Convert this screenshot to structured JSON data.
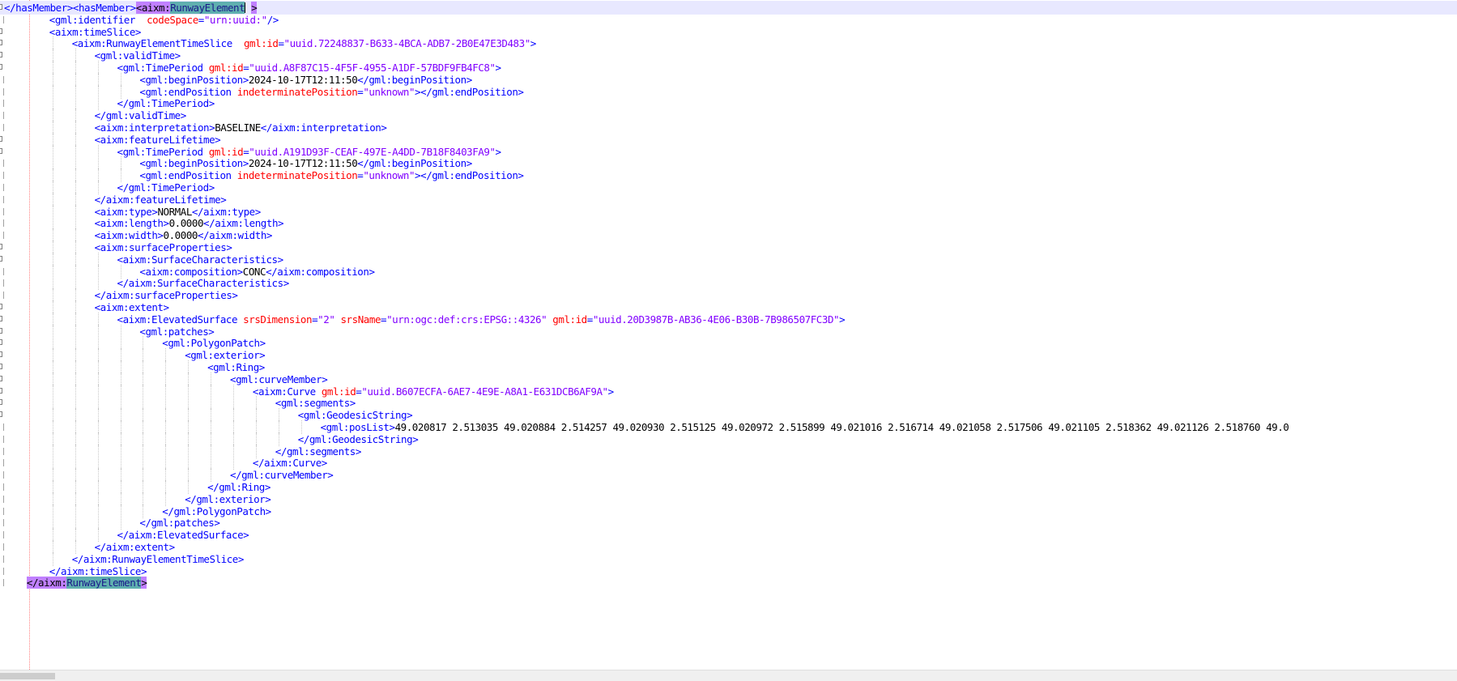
{
  "editor": {
    "lines": [
      {
        "indent": 0,
        "current": true,
        "fold": "box",
        "parts": [
          [
            "t",
            "</hasMember><hasMember>"
          ],
          [
            "hl",
            "<aixm:"
          ],
          [
            "hlsel",
            "RunwayElement"
          ],
          [
            "x",
            " "
          ],
          [
            "hl",
            ">"
          ]
        ]
      },
      {
        "indent": 2,
        "fold": "line",
        "parts": [
          [
            "t",
            "<gml:identifier  "
          ],
          [
            "a",
            "codeSpace"
          ],
          [
            "t",
            "="
          ],
          [
            "v",
            "\"urn:uuid:\""
          ],
          [
            "t",
            "/>"
          ]
        ]
      },
      {
        "indent": 2,
        "fold": "box",
        "parts": [
          [
            "t",
            "<aixm:timeSlice>"
          ]
        ]
      },
      {
        "indent": 3,
        "fold": "box",
        "parts": [
          [
            "t",
            "<aixm:RunwayElementTimeSlice  "
          ],
          [
            "a",
            "gml:id"
          ],
          [
            "t",
            "="
          ],
          [
            "v",
            "\"uuid.72248837-B633-4BCA-ADB7-2B0E47E3D483\""
          ],
          [
            "t",
            ">"
          ]
        ]
      },
      {
        "indent": 4,
        "fold": "box",
        "parts": [
          [
            "t",
            "<gml:validTime>"
          ]
        ]
      },
      {
        "indent": 5,
        "fold": "box",
        "parts": [
          [
            "t",
            "<gml:TimePeriod "
          ],
          [
            "a",
            "gml:id"
          ],
          [
            "t",
            "="
          ],
          [
            "v",
            "\"uuid.A8F87C15-4F5F-4955-A1DF-57BDF9FB4FC8\""
          ],
          [
            "t",
            ">"
          ]
        ]
      },
      {
        "indent": 6,
        "fold": "line",
        "parts": [
          [
            "t",
            "<gml:beginPosition>"
          ],
          [
            "x",
            "2024-10-17T12:11:50"
          ],
          [
            "t",
            "</gml:beginPosition>"
          ]
        ]
      },
      {
        "indent": 6,
        "fold": "line",
        "parts": [
          [
            "t",
            "<gml:endPosition "
          ],
          [
            "a",
            "indeterminatePosition"
          ],
          [
            "t",
            "="
          ],
          [
            "v",
            "\"unknown\""
          ],
          [
            "t",
            "></gml:endPosition>"
          ]
        ]
      },
      {
        "indent": 5,
        "fold": "line",
        "parts": [
          [
            "t",
            "</gml:TimePeriod>"
          ]
        ]
      },
      {
        "indent": 4,
        "fold": "line",
        "parts": [
          [
            "t",
            "</gml:validTime>"
          ]
        ]
      },
      {
        "indent": 4,
        "fold": "line",
        "parts": [
          [
            "t",
            "<aixm:interpretation>"
          ],
          [
            "x",
            "BASELINE"
          ],
          [
            "t",
            "</aixm:interpretation>"
          ]
        ]
      },
      {
        "indent": 4,
        "fold": "box",
        "parts": [
          [
            "t",
            "<aixm:featureLifetime>"
          ]
        ]
      },
      {
        "indent": 5,
        "fold": "box",
        "parts": [
          [
            "t",
            "<gml:TimePeriod "
          ],
          [
            "a",
            "gml:id"
          ],
          [
            "t",
            "="
          ],
          [
            "v",
            "\"uuid.A191D93F-CEAF-497E-A4DD-7B18F8403FA9\""
          ],
          [
            "t",
            ">"
          ]
        ]
      },
      {
        "indent": 6,
        "fold": "line",
        "parts": [
          [
            "t",
            "<gml:beginPosition>"
          ],
          [
            "x",
            "2024-10-17T12:11:50"
          ],
          [
            "t",
            "</gml:beginPosition>"
          ]
        ]
      },
      {
        "indent": 6,
        "fold": "line",
        "parts": [
          [
            "t",
            "<gml:endPosition "
          ],
          [
            "a",
            "indeterminatePosition"
          ],
          [
            "t",
            "="
          ],
          [
            "v",
            "\"unknown\""
          ],
          [
            "t",
            "></gml:endPosition>"
          ]
        ]
      },
      {
        "indent": 5,
        "fold": "line",
        "parts": [
          [
            "t",
            "</gml:TimePeriod>"
          ]
        ]
      },
      {
        "indent": 4,
        "fold": "line",
        "parts": [
          [
            "t",
            "</aixm:featureLifetime>"
          ]
        ]
      },
      {
        "indent": 4,
        "fold": "line",
        "parts": [
          [
            "t",
            "<aixm:type>"
          ],
          [
            "x",
            "NORMAL"
          ],
          [
            "t",
            "</aixm:type>"
          ]
        ]
      },
      {
        "indent": 4,
        "fold": "line",
        "parts": [
          [
            "t",
            "<aixm:length>"
          ],
          [
            "x",
            "0.0000"
          ],
          [
            "t",
            "</aixm:length>"
          ]
        ]
      },
      {
        "indent": 4,
        "fold": "line",
        "parts": [
          [
            "t",
            "<aixm:width>"
          ],
          [
            "x",
            "0.0000"
          ],
          [
            "t",
            "</aixm:width>"
          ]
        ]
      },
      {
        "indent": 4,
        "fold": "box",
        "parts": [
          [
            "t",
            "<aixm:surfaceProperties>"
          ]
        ]
      },
      {
        "indent": 5,
        "fold": "box",
        "parts": [
          [
            "t",
            "<aixm:SurfaceCharacteristics>"
          ]
        ]
      },
      {
        "indent": 6,
        "fold": "line",
        "parts": [
          [
            "t",
            "<aixm:composition>"
          ],
          [
            "x",
            "CONC"
          ],
          [
            "t",
            "</aixm:composition>"
          ]
        ]
      },
      {
        "indent": 5,
        "fold": "line",
        "parts": [
          [
            "t",
            "</aixm:SurfaceCharacteristics>"
          ]
        ]
      },
      {
        "indent": 4,
        "fold": "line",
        "parts": [
          [
            "t",
            "</aixm:surfaceProperties>"
          ]
        ]
      },
      {
        "indent": 4,
        "fold": "box",
        "parts": [
          [
            "t",
            "<aixm:extent>"
          ]
        ]
      },
      {
        "indent": 5,
        "fold": "box",
        "parts": [
          [
            "t",
            "<aixm:ElevatedSurface "
          ],
          [
            "a",
            "srsDimension"
          ],
          [
            "t",
            "="
          ],
          [
            "v",
            "\"2\""
          ],
          [
            "t",
            " "
          ],
          [
            "a",
            "srsName"
          ],
          [
            "t",
            "="
          ],
          [
            "v",
            "\"urn:ogc:def:crs:EPSG::4326\""
          ],
          [
            "t",
            " "
          ],
          [
            "a",
            "gml:id"
          ],
          [
            "t",
            "="
          ],
          [
            "v",
            "\"uuid.20D3987B-AB36-4E06-B30B-7B986507FC3D\""
          ],
          [
            "t",
            ">"
          ]
        ]
      },
      {
        "indent": 6,
        "fold": "box",
        "parts": [
          [
            "t",
            "<gml:patches>"
          ]
        ]
      },
      {
        "indent": 7,
        "fold": "box",
        "parts": [
          [
            "t",
            "<gml:PolygonPatch>"
          ]
        ]
      },
      {
        "indent": 8,
        "fold": "box",
        "parts": [
          [
            "t",
            "<gml:exterior>"
          ]
        ]
      },
      {
        "indent": 9,
        "fold": "box",
        "parts": [
          [
            "t",
            "<gml:Ring>"
          ]
        ]
      },
      {
        "indent": 10,
        "fold": "box",
        "parts": [
          [
            "t",
            "<gml:curveMember>"
          ]
        ]
      },
      {
        "indent": 11,
        "fold": "box",
        "parts": [
          [
            "t",
            "<aixm:Curve "
          ],
          [
            "a",
            "gml:id"
          ],
          [
            "t",
            "="
          ],
          [
            "v",
            "\"uuid.B607ECFA-6AE7-4E9E-A8A1-E631DCB6AF9A\""
          ],
          [
            "t",
            ">"
          ]
        ]
      },
      {
        "indent": 12,
        "fold": "box",
        "parts": [
          [
            "t",
            "<gml:segments>"
          ]
        ]
      },
      {
        "indent": 13,
        "fold": "box",
        "parts": [
          [
            "t",
            "<gml:GeodesicString>"
          ]
        ]
      },
      {
        "indent": 14,
        "fold": "line",
        "parts": [
          [
            "t",
            "<gml:posList>"
          ],
          [
            "x",
            "49.020817 2.513035 49.020884 2.514257 49.020930 2.515125 49.020972 2.515899 49.021016 2.516714 49.021058 2.517506 49.021105 2.518362 49.021126 2.518760 49.0"
          ]
        ]
      },
      {
        "indent": 13,
        "fold": "line",
        "parts": [
          [
            "t",
            "</gml:GeodesicString>"
          ]
        ]
      },
      {
        "indent": 12,
        "fold": "line",
        "parts": [
          [
            "t",
            "</gml:segments>"
          ]
        ]
      },
      {
        "indent": 11,
        "fold": "line",
        "parts": [
          [
            "t",
            "</aixm:Curve>"
          ]
        ]
      },
      {
        "indent": 10,
        "fold": "line",
        "parts": [
          [
            "t",
            "</gml:curveMember>"
          ]
        ]
      },
      {
        "indent": 9,
        "fold": "line",
        "parts": [
          [
            "t",
            "</gml:Ring>"
          ]
        ]
      },
      {
        "indent": 8,
        "fold": "line",
        "parts": [
          [
            "t",
            "</gml:exterior>"
          ]
        ]
      },
      {
        "indent": 7,
        "fold": "line",
        "parts": [
          [
            "t",
            "</gml:PolygonPatch>"
          ]
        ]
      },
      {
        "indent": 6,
        "fold": "line",
        "parts": [
          [
            "t",
            "</gml:patches>"
          ]
        ]
      },
      {
        "indent": 5,
        "fold": "line",
        "parts": [
          [
            "t",
            "</aixm:ElevatedSurface>"
          ]
        ]
      },
      {
        "indent": 4,
        "fold": "line",
        "parts": [
          [
            "t",
            "</aixm:extent>"
          ]
        ]
      },
      {
        "indent": 3,
        "fold": "line",
        "parts": [
          [
            "t",
            "</aixm:RunwayElementTimeSlice>"
          ]
        ]
      },
      {
        "indent": 2,
        "fold": "line",
        "parts": [
          [
            "t",
            "</aixm:timeSlice>"
          ]
        ]
      },
      {
        "indent": 1,
        "fold": "line",
        "parts": [
          [
            "hl",
            "</aixm:"
          ],
          [
            "hlsel",
            "RunwayElement"
          ],
          [
            "hl",
            ">"
          ]
        ]
      }
    ]
  },
  "colors": {
    "tag": "#0000ff",
    "attribute": "#ff0000",
    "value": "#8000ff",
    "text": "#000000",
    "match_highlight": "#c080ff",
    "selection": "#5fafaf",
    "current_line": "#e8e8ff"
  }
}
